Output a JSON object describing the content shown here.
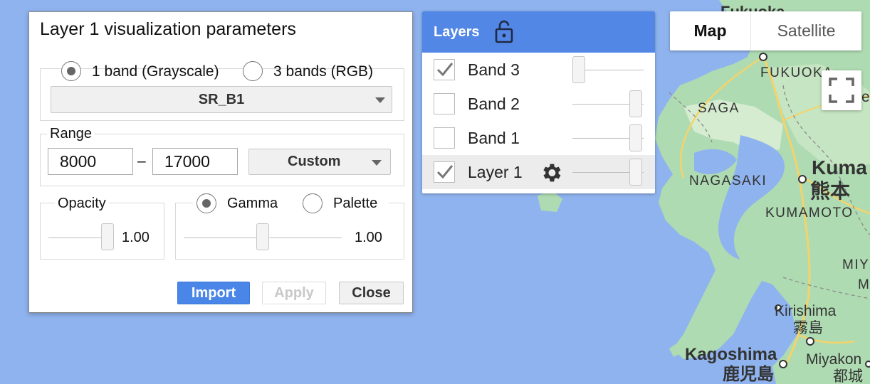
{
  "viz_dialog": {
    "title": "Layer 1 visualization parameters",
    "band_mode": {
      "one_band_label": "1 band (Grayscale)",
      "three_bands_label": "3 bands (RGB)",
      "selected": "1 band (Grayscale)"
    },
    "band_select": {
      "value": "SR_B1"
    },
    "range": {
      "label": "Range",
      "min": "8000",
      "separator": "–",
      "max": "17000",
      "mode": "Custom"
    },
    "opacity": {
      "label": "Opacity",
      "value": "1.00",
      "level": 1.0
    },
    "stretch_mode": {
      "gamma_label": "Gamma",
      "palette_label": "Palette",
      "selected": "Gamma"
    },
    "gamma": {
      "value": "1.00"
    },
    "buttons": {
      "import": "Import",
      "apply": "Apply",
      "close": "Close"
    }
  },
  "layers_panel": {
    "title": "Layers",
    "lock_icon": "unlock-icon",
    "items": [
      {
        "label": "Band 3",
        "checked": true,
        "opacity": 0.0
      },
      {
        "label": "Band 2",
        "checked": false,
        "opacity": 1.0
      },
      {
        "label": "Band 1",
        "checked": false,
        "opacity": 1.0
      },
      {
        "label": "Layer 1",
        "checked": true,
        "opacity": 1.0,
        "icon": "gear-icon"
      }
    ]
  },
  "map_type": {
    "map": "Map",
    "satellite": "Satellite",
    "selected": "Map"
  },
  "fullscreen": {
    "icon": "fullscreen-icon"
  },
  "map_labels": {
    "fukuoka_top": "Fukuoka",
    "fukuoka": "FUKUOKA",
    "saga": "SAGA",
    "nagasaki": "NAGASAKI",
    "kumamoto_city": "Kuma",
    "kumamoto_kanji": "熊本",
    "kumamoto_pref": "KUMAMOTO",
    "miyazaki_pref": "MIY",
    "miyazaki_pref2": "M",
    "kirishima": "Kirishima",
    "kirishima_kanji": "霧島",
    "kagoshima": "Kagoshima",
    "kagoshima_kanji": "鹿児島",
    "miyakonojo": "Miyakon",
    "miyakonojo_kanji": "都城",
    "edge_e": "e"
  },
  "colors": {
    "water": "#8fb3ee",
    "land": "#aedbb2",
    "land_light": "#d6ecd0",
    "road": "#f5d36b",
    "header_blue": "#5387e6",
    "import_blue": "#4a86e8"
  }
}
